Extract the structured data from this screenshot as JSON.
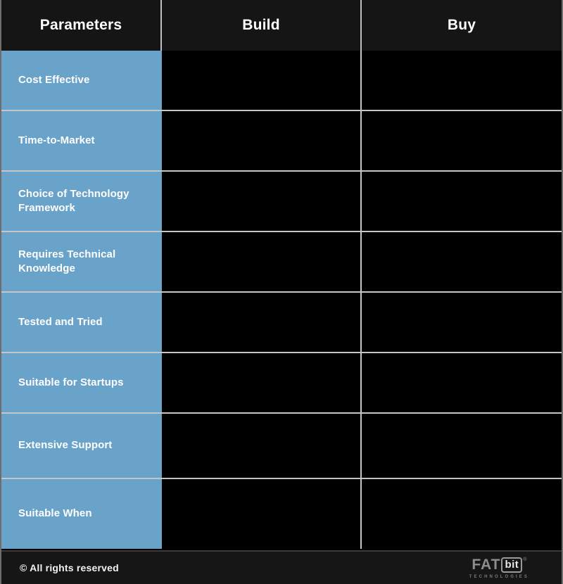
{
  "table": {
    "headers": {
      "parameters": "Parameters",
      "build": "Build",
      "buy": "Buy"
    },
    "rows": [
      {
        "parameter": "Cost Effective",
        "build": "",
        "buy": ""
      },
      {
        "parameter": "Time-to-Market",
        "build": "",
        "buy": ""
      },
      {
        "parameter": "Choice of Technology Framework",
        "build": "",
        "buy": ""
      },
      {
        "parameter": "Requires Technical Knowledge",
        "build": "",
        "buy": ""
      },
      {
        "parameter": "Tested and Tried",
        "build": "",
        "buy": ""
      },
      {
        "parameter": "Suitable for Startups",
        "build": "",
        "buy": ""
      },
      {
        "parameter": "Extensive Support",
        "build": "",
        "buy": ""
      },
      {
        "parameter": "Suitable When",
        "build": "",
        "buy": ""
      }
    ]
  },
  "footer": {
    "copyright": "© All rights reserved",
    "logo": {
      "fat": "FAT",
      "bit": "bit",
      "tm": "®",
      "tagline": "TECHNOLOGIES"
    }
  },
  "colors": {
    "accent_blue": "#6aa3ca",
    "header_bg": "#151515",
    "cell_bg": "#000000",
    "divider": "#c6c6c6",
    "footer_bg": "#161616",
    "text": "#ffffff"
  }
}
